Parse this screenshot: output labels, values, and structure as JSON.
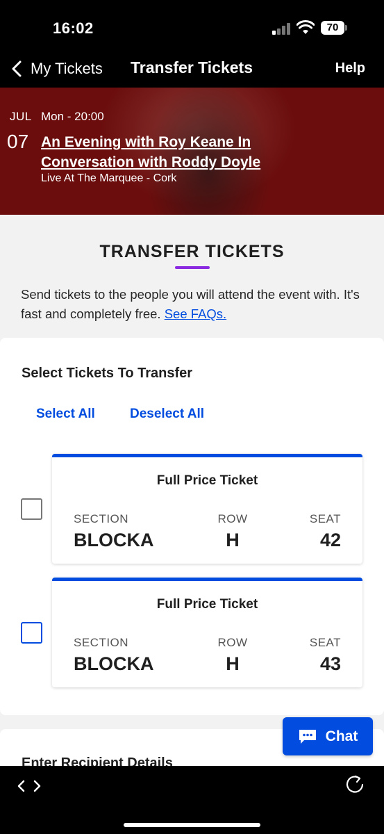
{
  "status": {
    "time": "16:02",
    "battery": "70"
  },
  "nav": {
    "back_label": "My Tickets",
    "title": "Transfer Tickets",
    "help": "Help"
  },
  "event": {
    "month": "JUL",
    "when": "Mon - 20:00",
    "day": "07",
    "title": "An Evening with Roy Keane In Conversation with Roddy Doyle",
    "venue": "Live At The Marquee - Cork"
  },
  "transfer": {
    "heading": "TRANSFER TICKETS",
    "intro": "Send tickets to the people you will attend the event with. It's fast and completely free.",
    "faq_link": "See FAQs."
  },
  "select": {
    "heading": "Select Tickets To Transfer",
    "select_all": "Select All",
    "deselect_all": "Deselect All",
    "tickets": [
      {
        "type": "Full Price Ticket",
        "section_label": "SECTION",
        "section": "BLOCKA",
        "row_label": "ROW",
        "row": "H",
        "seat_label": "SEAT",
        "seat": "42",
        "checked": false
      },
      {
        "type": "Full Price Ticket",
        "section_label": "SECTION",
        "section": "BLOCKA",
        "row_label": "ROW",
        "row": "H",
        "seat_label": "SEAT",
        "seat": "43",
        "checked": false
      }
    ]
  },
  "recipient": {
    "heading": "Enter Recipient Details"
  },
  "chat": {
    "label": "Chat"
  },
  "colors": {
    "accent": "#024ddf",
    "banner": "#6b0d0d",
    "underline": "#8a2be2"
  }
}
